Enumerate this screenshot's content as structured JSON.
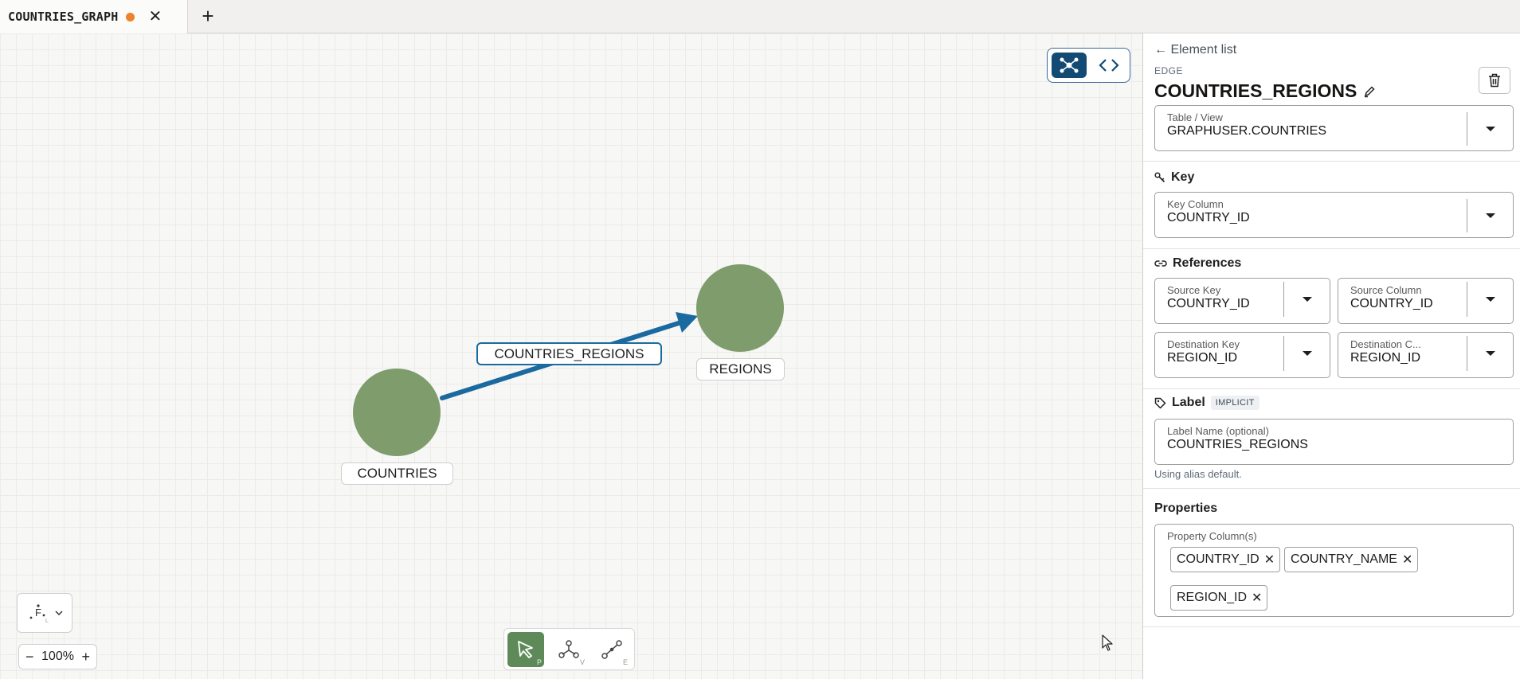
{
  "tab": {
    "title": "COUNTRIES_GRAPH",
    "modified": true,
    "close_glyph": "✕",
    "add_glyph": "+"
  },
  "canvas": {
    "nodes": [
      {
        "label": "COUNTRIES",
        "color": "#7f9c6c"
      },
      {
        "label": "REGIONS",
        "color": "#7f9c6c"
      }
    ],
    "edge": {
      "label": "COUNTRIES_REGIONS",
      "color": "#1a6aa0"
    },
    "zoom": {
      "minus": "−",
      "value": "100%",
      "plus": "+"
    },
    "tools": [
      {
        "name": "select",
        "hint": "P",
        "active": true
      },
      {
        "name": "vertex",
        "hint": "V",
        "active": false
      },
      {
        "name": "edge",
        "hint": "E",
        "active": false
      }
    ]
  },
  "panel": {
    "back_label": "← Element list",
    "kind": "EDGE",
    "title": "COUNTRIES_REGIONS",
    "table_view": {
      "label": "Table / View",
      "value": "GRAPHUSER.COUNTRIES"
    },
    "key": {
      "heading": "Key",
      "column_label": "Key Column",
      "column_value": "COUNTRY_ID"
    },
    "references": {
      "heading": "References",
      "source_key": {
        "label": "Source Key",
        "value": "COUNTRY_ID"
      },
      "source_column": {
        "label": "Source Column",
        "value": "COUNTRY_ID"
      },
      "destination_key": {
        "label": "Destination Key",
        "value": "REGION_ID"
      },
      "destination_column": {
        "label": "Destination C...",
        "value": "REGION_ID"
      }
    },
    "label_section": {
      "heading": "Label",
      "badge": "IMPLICIT",
      "name_label": "Label Name (optional)",
      "name_value": "COUNTRIES_REGIONS",
      "helper": "Using alias default."
    },
    "properties": {
      "heading": "Properties",
      "field_label": "Property Column(s)",
      "chips": [
        "COUNTRY_ID",
        "COUNTRY_NAME",
        "REGION_ID"
      ]
    }
  },
  "colors": {
    "accent": "#124a74",
    "active_tool": "#5d8a58",
    "unsaved_dot": "#f0802a"
  }
}
